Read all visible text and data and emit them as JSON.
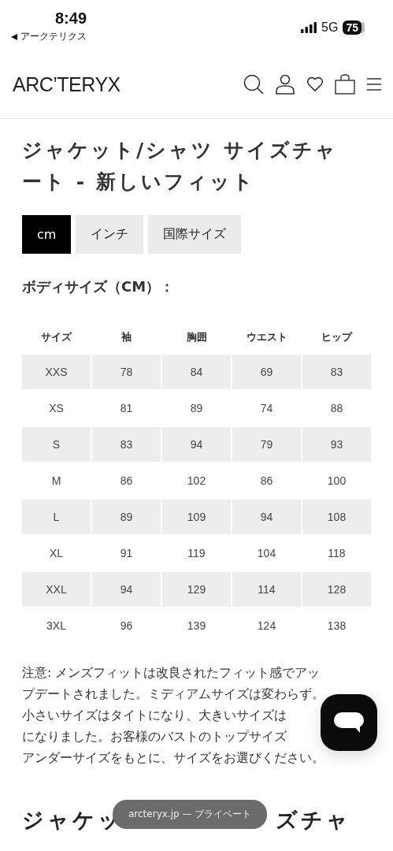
{
  "status_bar": {
    "time": "8:49",
    "back_label": "アークテリクス",
    "network": "5G",
    "battery": "75"
  },
  "header": {
    "logo": "ARC’TERYX"
  },
  "title": "ジャケット/シャツ サイズチャート - 新しいフィット",
  "tabs": [
    {
      "label": "cm",
      "selected": true
    },
    {
      "label": "インチ",
      "selected": false
    },
    {
      "label": "国際サイズ",
      "selected": false
    }
  ],
  "section_title": "ボディサイズ（CM）：",
  "table": {
    "columns": [
      "サイズ",
      "袖",
      "胸囲",
      "ウエスト",
      "ヒップ"
    ],
    "rows": [
      [
        "XXS",
        "78",
        "84",
        "69",
        "83"
      ],
      [
        "XS",
        "81",
        "89",
        "74",
        "88"
      ],
      [
        "S",
        "83",
        "94",
        "79",
        "93"
      ],
      [
        "M",
        "86",
        "102",
        "86",
        "100"
      ],
      [
        "L",
        "89",
        "109",
        "94",
        "108"
      ],
      [
        "XL",
        "91",
        "119",
        "104",
        "118"
      ],
      [
        "XXL",
        "94",
        "129",
        "114",
        "128"
      ],
      [
        "3XL",
        "96",
        "139",
        "124",
        "138"
      ]
    ]
  },
  "note_lines": [
    "注意: メンズフィットは改良されたフィット感でアッ",
    "プデートされました。ミディアムサイズは変わらず。",
    "小さいサイズはタイトになり、大きいサイズは",
    "になりました。お客様のバストのトップサイズ",
    "アンダーサイズをもとに、サイズをお選びください。"
  ],
  "next_heading": {
    "left": "ジャケッ",
    "right": "ズチャ"
  },
  "url_pill": "arcteryx.jp — プライベート"
}
